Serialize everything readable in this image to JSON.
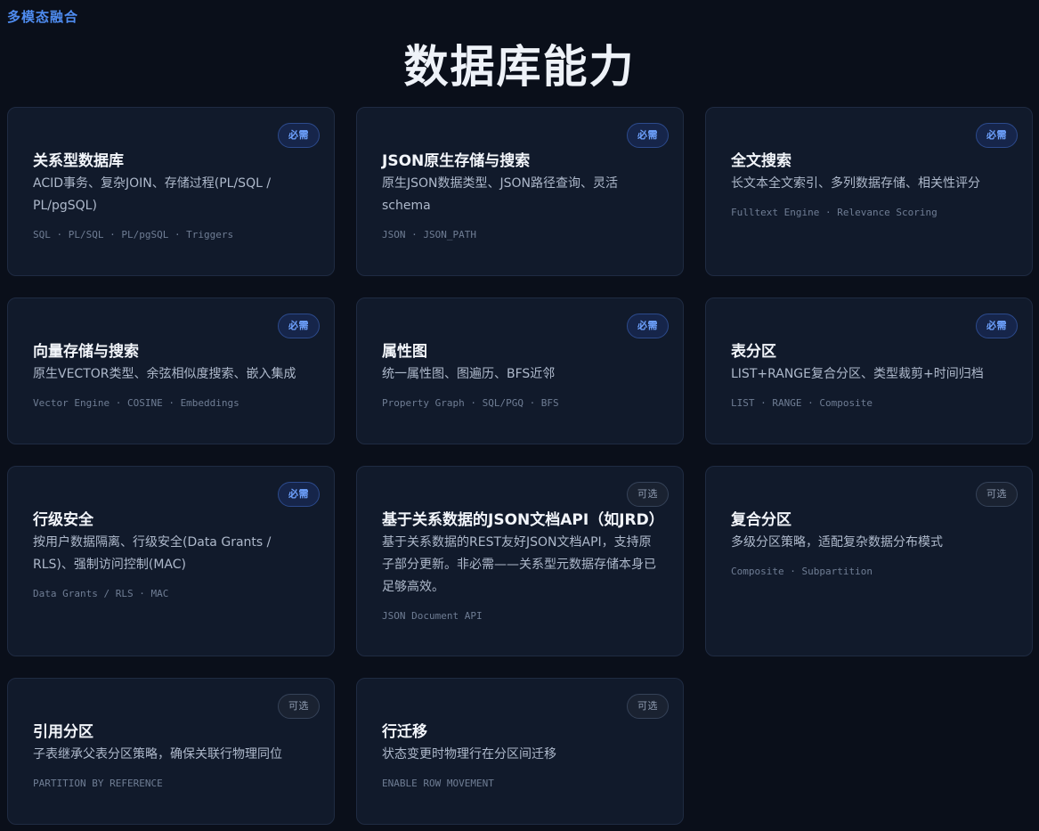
{
  "header": {
    "eyebrow": "多模态融合",
    "title": "数据库能力"
  },
  "cards": [
    {
      "title": "关系型数据库",
      "badge": "必需",
      "badge_type": "required",
      "desc": "ACID事务、复杂JOIN、存储过程(PL/SQL / PL/pgSQL)",
      "tags": "SQL · PL/SQL · PL/pgSQL · Triggers"
    },
    {
      "title": "JSON原生存储与搜索",
      "badge": "必需",
      "badge_type": "required",
      "desc": "原生JSON数据类型、JSON路径查询、灵活schema",
      "tags": "JSON · JSON_PATH"
    },
    {
      "title": "全文搜索",
      "badge": "必需",
      "badge_type": "required",
      "desc": "长文本全文索引、多列数据存储、相关性评分",
      "tags": "Fulltext Engine · Relevance Scoring"
    },
    {
      "title": "向量存储与搜索",
      "badge": "必需",
      "badge_type": "required",
      "desc": "原生VECTOR类型、余弦相似度搜索、嵌入集成",
      "tags": "Vector Engine · COSINE · Embeddings"
    },
    {
      "title": "属性图",
      "badge": "必需",
      "badge_type": "required",
      "desc": "统一属性图、图遍历、BFS近邻",
      "tags": "Property Graph · SQL/PGQ · BFS"
    },
    {
      "title": "表分区",
      "badge": "必需",
      "badge_type": "required",
      "desc": "LIST+RANGE复合分区、类型裁剪+时间归档",
      "tags": "LIST · RANGE · Composite"
    },
    {
      "title": "行级安全",
      "badge": "必需",
      "badge_type": "required",
      "desc": "按用户数据隔离、行级安全(Data Grants / RLS)、强制访问控制(MAC)",
      "tags": "Data Grants / RLS · MAC"
    },
    {
      "title": "基于关系数据的JSON文档API（如JRD）",
      "badge": "可选",
      "badge_type": "optional",
      "desc": "基于关系数据的REST友好JSON文档API，支持原子部分更新。非必需——关系型元数据存储本身已足够高效。",
      "tags": "JSON Document API"
    },
    {
      "title": "复合分区",
      "badge": "可选",
      "badge_type": "optional",
      "desc": "多级分区策略，适配复杂数据分布模式",
      "tags": "Composite · Subpartition"
    },
    {
      "title": "引用分区",
      "badge": "可选",
      "badge_type": "optional",
      "desc": "子表继承父表分区策略，确保关联行物理同位",
      "tags": "PARTITION BY REFERENCE"
    },
    {
      "title": "行迁移",
      "badge": "可选",
      "badge_type": "optional",
      "desc": "状态变更时物理行在分区间迁移",
      "tags": "ENABLE ROW MOVEMENT"
    }
  ]
}
